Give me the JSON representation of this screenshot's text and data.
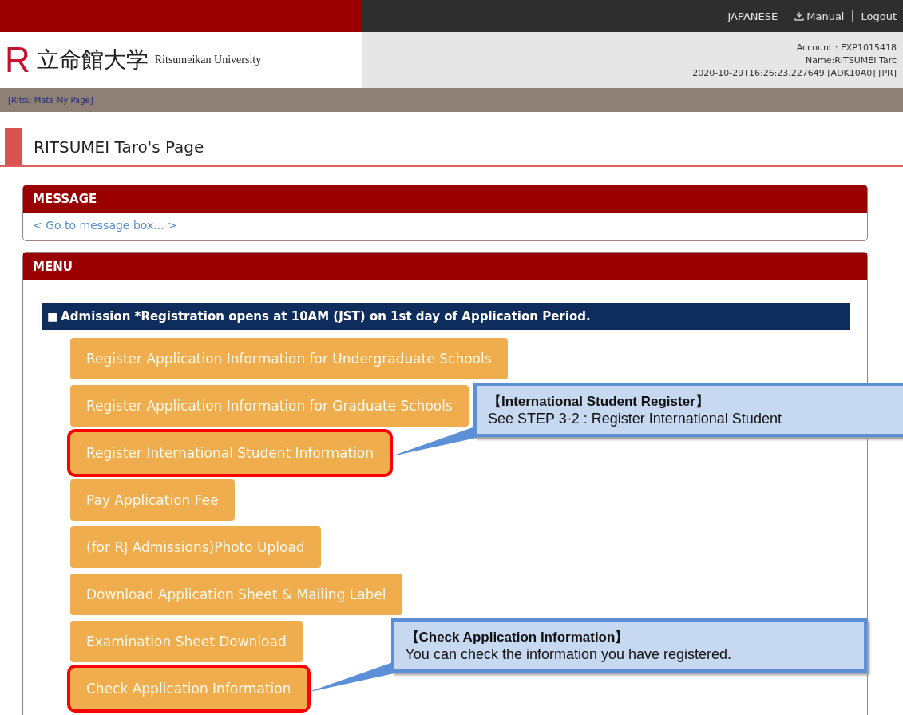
{
  "top_bar": {
    "links": [
      "JAPANESE",
      "Manual",
      "Logout"
    ]
  },
  "header": {
    "logo_letter": "R",
    "logo_kanji": "立命館大学",
    "logo_english": "Ritsumeikan University",
    "account": "Account : EXP1015418",
    "name": "Name:RITSUMEI Tarc",
    "timestamp": "2020-10-29T16:26:23.227649 [ADK10A0] [PR]"
  },
  "nav": {
    "breadcrumb": "[Ritsu-Mate My Page]"
  },
  "page_title": "RITSUMEI Taro's Page",
  "message_panel": {
    "title": "MESSAGE",
    "link": "< Go to message box... >"
  },
  "menu_panel": {
    "title": "MENU",
    "section": {
      "bullet": "■",
      "title": "Admission *Registration opens at 10AM (JST) on 1st day of Application Period."
    },
    "buttons": [
      {
        "label": "Register Application Information for Undergraduate Schools",
        "highlighted": false
      },
      {
        "label": "Register Application Information for Graduate Schools",
        "highlighted": false
      },
      {
        "label": "Register International Student Information",
        "highlighted": true,
        "callout": {
          "title": "【International Student Register】",
          "text": "See STEP 3-2 : Register International Student"
        }
      },
      {
        "label": "Pay Application Fee",
        "highlighted": false
      },
      {
        "label": "(for RJ Admissions)Photo Upload",
        "highlighted": false
      },
      {
        "label": "Download Application Sheet & Mailing Label",
        "highlighted": false
      },
      {
        "label": "Examination Sheet Download",
        "highlighted": false
      },
      {
        "label": "Check Application Information",
        "highlighted": true,
        "callout": {
          "title": "【Check Application Information】",
          "text": "You can check the information you have registered."
        }
      }
    ]
  }
}
